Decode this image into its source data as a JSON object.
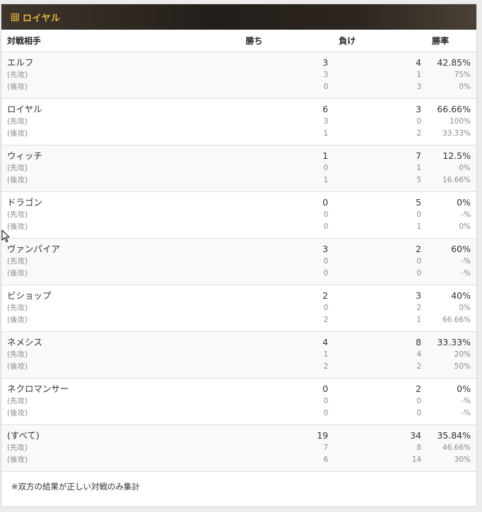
{
  "panel": {
    "title": "ロイヤル",
    "icon": "grid-icon",
    "accent_color": "#e8b53a"
  },
  "columns": {
    "opponent": "対戦相手",
    "wins": "勝ち",
    "losses": "負け",
    "rate": "勝率"
  },
  "rows": [
    {
      "name": "エルフ",
      "total": {
        "wins": "3",
        "losses": "4",
        "rate": "42.85%"
      },
      "first": {
        "label": "(先攻)",
        "wins": "3",
        "losses": "1",
        "rate": "75%"
      },
      "second": {
        "label": "(後攻)",
        "wins": "0",
        "losses": "3",
        "rate": "0%"
      }
    },
    {
      "name": "ロイヤル",
      "total": {
        "wins": "6",
        "losses": "3",
        "rate": "66.66%"
      },
      "first": {
        "label": "(先攻)",
        "wins": "3",
        "losses": "0",
        "rate": "100%"
      },
      "second": {
        "label": "(後攻)",
        "wins": "1",
        "losses": "2",
        "rate": "33.33%"
      }
    },
    {
      "name": "ウィッチ",
      "total": {
        "wins": "1",
        "losses": "7",
        "rate": "12.5%"
      },
      "first": {
        "label": "(先攻)",
        "wins": "0",
        "losses": "1",
        "rate": "0%"
      },
      "second": {
        "label": "(後攻)",
        "wins": "1",
        "losses": "5",
        "rate": "16.66%"
      }
    },
    {
      "name": "ドラゴン",
      "total": {
        "wins": "0",
        "losses": "5",
        "rate": "0%"
      },
      "first": {
        "label": "(先攻)",
        "wins": "0",
        "losses": "0",
        "rate": "-%"
      },
      "second": {
        "label": "(後攻)",
        "wins": "0",
        "losses": "1",
        "rate": "0%"
      }
    },
    {
      "name": "ヴァンパイア",
      "total": {
        "wins": "3",
        "losses": "2",
        "rate": "60%"
      },
      "first": {
        "label": "(先攻)",
        "wins": "0",
        "losses": "0",
        "rate": "-%"
      },
      "second": {
        "label": "(後攻)",
        "wins": "0",
        "losses": "0",
        "rate": "-%"
      }
    },
    {
      "name": "ビショップ",
      "total": {
        "wins": "2",
        "losses": "3",
        "rate": "40%"
      },
      "first": {
        "label": "(先攻)",
        "wins": "0",
        "losses": "2",
        "rate": "0%"
      },
      "second": {
        "label": "(後攻)",
        "wins": "2",
        "losses": "1",
        "rate": "66.66%"
      }
    },
    {
      "name": "ネメシス",
      "total": {
        "wins": "4",
        "losses": "8",
        "rate": "33.33%"
      },
      "first": {
        "label": "(先攻)",
        "wins": "1",
        "losses": "4",
        "rate": "20%"
      },
      "second": {
        "label": "(後攻)",
        "wins": "2",
        "losses": "2",
        "rate": "50%"
      }
    },
    {
      "name": "ネクロマンサー",
      "total": {
        "wins": "0",
        "losses": "2",
        "rate": "0%"
      },
      "first": {
        "label": "(先攻)",
        "wins": "0",
        "losses": "0",
        "rate": "-%"
      },
      "second": {
        "label": "(後攻)",
        "wins": "0",
        "losses": "0",
        "rate": "-%"
      }
    },
    {
      "name": "(すべて)",
      "total": {
        "wins": "19",
        "losses": "34",
        "rate": "35.84%"
      },
      "first": {
        "label": "(先攻)",
        "wins": "7",
        "losses": "8",
        "rate": "46.66%"
      },
      "second": {
        "label": "(後攻)",
        "wins": "6",
        "losses": "14",
        "rate": "30%"
      }
    }
  ],
  "footnote": "※双方の結果が正しい対戦のみ集計"
}
